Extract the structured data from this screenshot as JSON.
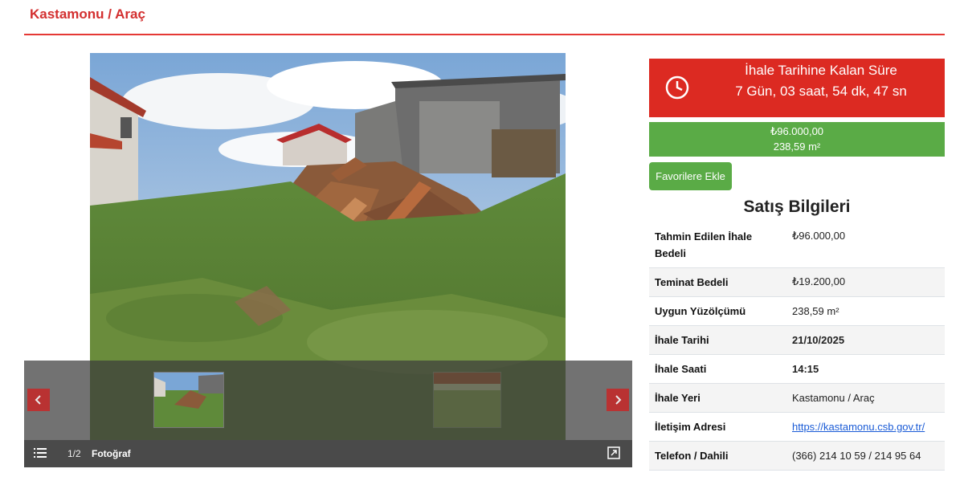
{
  "header": {
    "title": "Kastamonu / Araç"
  },
  "gallery": {
    "counter": "1/2",
    "caption": "Fotoğraf",
    "icons": {
      "prev": "chevron-left-icon",
      "next": "chevron-right-icon",
      "list": "list-icon",
      "expand": "expand-icon"
    }
  },
  "countdown": {
    "label": "İhale Tarihine Kalan Süre",
    "time": "7 Gün, 03 saat, 54 dk, 47 sn",
    "icon": "clock-icon"
  },
  "price": {
    "amount": "₺96.000,00",
    "area": "238,59 m²"
  },
  "favorite_button": "Favorilere Ekle",
  "sales_info": {
    "title": "Satış Bilgileri",
    "rows": [
      {
        "key": "Tahmin Edilen İhale Bedeli",
        "value": "₺96.000,00"
      },
      {
        "key": "Teminat Bedeli",
        "value": "₺19.200,00"
      },
      {
        "key": "Uygun Yüzölçümü",
        "value": "238,59 m²"
      },
      {
        "key": "İhale Tarihi",
        "value": "21/10/2025"
      },
      {
        "key": "İhale Saati",
        "value": "14:15"
      },
      {
        "key": "İhale Yeri",
        "value": "Kastamonu / Araç"
      },
      {
        "key": "İletişim Adresi",
        "value": "https://kastamonu.csb.gov.tr/"
      },
      {
        "key": "Telefon / Dahili",
        "value": "(366) 214 10 59 / 214 95 64"
      }
    ]
  },
  "colors": {
    "accent_red": "#dc2a22",
    "accent_green": "#5aab46",
    "link_blue": "#1a5bd6"
  }
}
